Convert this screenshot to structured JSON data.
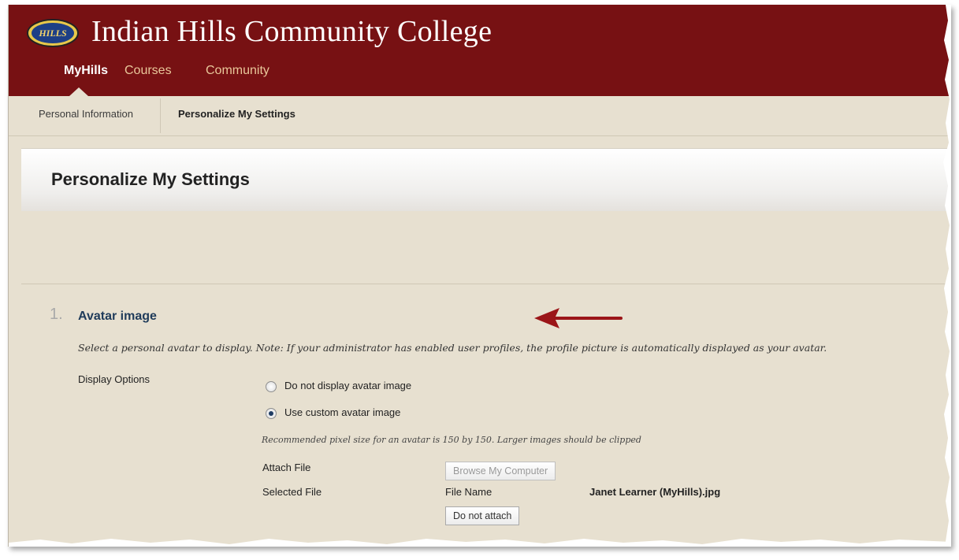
{
  "header": {
    "college_name": "Indian Hills Community College",
    "logo_text": "HILLS",
    "tabs": [
      {
        "label": "MyHills",
        "active": true
      },
      {
        "label": "Courses",
        "active": false
      },
      {
        "label": "Community",
        "active": false
      }
    ]
  },
  "subnav": {
    "items": [
      {
        "label": "Personal Information"
      },
      {
        "label": "Personalize My Settings"
      }
    ]
  },
  "page": {
    "title": "Personalize My Settings"
  },
  "avatar_section": {
    "step_number": "1.",
    "title": "Avatar image",
    "instructions": "Select a personal avatar to display. Note: If your administrator has enabled user profiles, the profile picture is automatically displayed as your avatar.",
    "display_options_label": "Display Options",
    "options": [
      {
        "label": "Do not display avatar image",
        "checked": false
      },
      {
        "label": "Use custom avatar image",
        "checked": true
      }
    ],
    "hint": "Recommended pixel size for an avatar is 150 by 150. Larger images should be clipped",
    "attach_file_label": "Attach File",
    "browse_button": "Browse My Computer",
    "selected_file_label": "Selected File",
    "file_name_label": "File Name",
    "file_name_value": "Janet Learner (MyHills).jpg",
    "do_not_attach_button": "Do not attach"
  },
  "colors": {
    "header_bg": "#771113",
    "page_bg": "#e7e0d0",
    "tab_inactive": "#e9c79a",
    "arrow": "#9b1518"
  },
  "icons": [
    "hills-logo-icon",
    "radio-icon",
    "annotation-arrow-icon"
  ]
}
